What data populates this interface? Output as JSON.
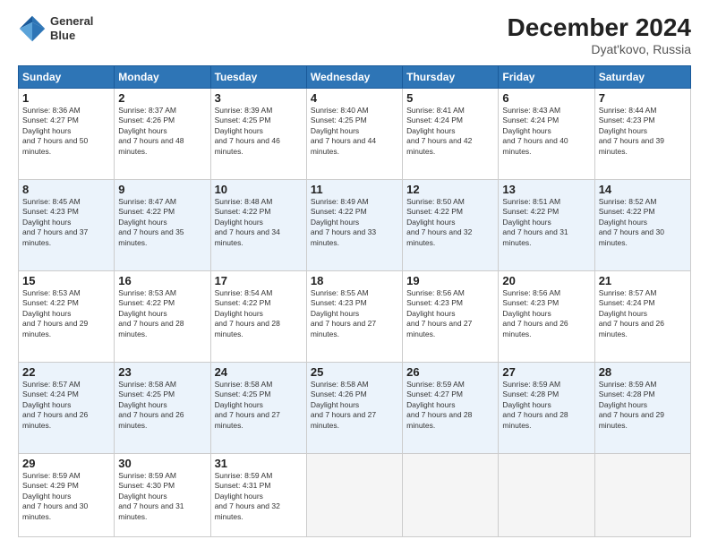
{
  "header": {
    "logo_line1": "General",
    "logo_line2": "Blue",
    "title": "December 2024",
    "subtitle": "Dyat'kovo, Russia"
  },
  "days_of_week": [
    "Sunday",
    "Monday",
    "Tuesday",
    "Wednesday",
    "Thursday",
    "Friday",
    "Saturday"
  ],
  "weeks": [
    {
      "stripe": false,
      "days": [
        {
          "num": "1",
          "rise": "8:36 AM",
          "set": "4:27 PM",
          "daylight": "7 hours and 50 minutes."
        },
        {
          "num": "2",
          "rise": "8:37 AM",
          "set": "4:26 PM",
          "daylight": "7 hours and 48 minutes."
        },
        {
          "num": "3",
          "rise": "8:39 AM",
          "set": "4:25 PM",
          "daylight": "7 hours and 46 minutes."
        },
        {
          "num": "4",
          "rise": "8:40 AM",
          "set": "4:25 PM",
          "daylight": "7 hours and 44 minutes."
        },
        {
          "num": "5",
          "rise": "8:41 AM",
          "set": "4:24 PM",
          "daylight": "7 hours and 42 minutes."
        },
        {
          "num": "6",
          "rise": "8:43 AM",
          "set": "4:24 PM",
          "daylight": "7 hours and 40 minutes."
        },
        {
          "num": "7",
          "rise": "8:44 AM",
          "set": "4:23 PM",
          "daylight": "7 hours and 39 minutes."
        }
      ]
    },
    {
      "stripe": true,
      "days": [
        {
          "num": "8",
          "rise": "8:45 AM",
          "set": "4:23 PM",
          "daylight": "7 hours and 37 minutes."
        },
        {
          "num": "9",
          "rise": "8:47 AM",
          "set": "4:22 PM",
          "daylight": "7 hours and 35 minutes."
        },
        {
          "num": "10",
          "rise": "8:48 AM",
          "set": "4:22 PM",
          "daylight": "7 hours and 34 minutes."
        },
        {
          "num": "11",
          "rise": "8:49 AM",
          "set": "4:22 PM",
          "daylight": "7 hours and 33 minutes."
        },
        {
          "num": "12",
          "rise": "8:50 AM",
          "set": "4:22 PM",
          "daylight": "7 hours and 32 minutes."
        },
        {
          "num": "13",
          "rise": "8:51 AM",
          "set": "4:22 PM",
          "daylight": "7 hours and 31 minutes."
        },
        {
          "num": "14",
          "rise": "8:52 AM",
          "set": "4:22 PM",
          "daylight": "7 hours and 30 minutes."
        }
      ]
    },
    {
      "stripe": false,
      "days": [
        {
          "num": "15",
          "rise": "8:53 AM",
          "set": "4:22 PM",
          "daylight": "7 hours and 29 minutes."
        },
        {
          "num": "16",
          "rise": "8:53 AM",
          "set": "4:22 PM",
          "daylight": "7 hours and 28 minutes."
        },
        {
          "num": "17",
          "rise": "8:54 AM",
          "set": "4:22 PM",
          "daylight": "7 hours and 28 minutes."
        },
        {
          "num": "18",
          "rise": "8:55 AM",
          "set": "4:23 PM",
          "daylight": "7 hours and 27 minutes."
        },
        {
          "num": "19",
          "rise": "8:56 AM",
          "set": "4:23 PM",
          "daylight": "7 hours and 27 minutes."
        },
        {
          "num": "20",
          "rise": "8:56 AM",
          "set": "4:23 PM",
          "daylight": "7 hours and 26 minutes."
        },
        {
          "num": "21",
          "rise": "8:57 AM",
          "set": "4:24 PM",
          "daylight": "7 hours and 26 minutes."
        }
      ]
    },
    {
      "stripe": true,
      "days": [
        {
          "num": "22",
          "rise": "8:57 AM",
          "set": "4:24 PM",
          "daylight": "7 hours and 26 minutes."
        },
        {
          "num": "23",
          "rise": "8:58 AM",
          "set": "4:25 PM",
          "daylight": "7 hours and 26 minutes."
        },
        {
          "num": "24",
          "rise": "8:58 AM",
          "set": "4:25 PM",
          "daylight": "7 hours and 27 minutes."
        },
        {
          "num": "25",
          "rise": "8:58 AM",
          "set": "4:26 PM",
          "daylight": "7 hours and 27 minutes."
        },
        {
          "num": "26",
          "rise": "8:59 AM",
          "set": "4:27 PM",
          "daylight": "7 hours and 28 minutes."
        },
        {
          "num": "27",
          "rise": "8:59 AM",
          "set": "4:28 PM",
          "daylight": "7 hours and 28 minutes."
        },
        {
          "num": "28",
          "rise": "8:59 AM",
          "set": "4:28 PM",
          "daylight": "7 hours and 29 minutes."
        }
      ]
    },
    {
      "stripe": false,
      "days": [
        {
          "num": "29",
          "rise": "8:59 AM",
          "set": "4:29 PM",
          "daylight": "7 hours and 30 minutes."
        },
        {
          "num": "30",
          "rise": "8:59 AM",
          "set": "4:30 PM",
          "daylight": "7 hours and 31 minutes."
        },
        {
          "num": "31",
          "rise": "8:59 AM",
          "set": "4:31 PM",
          "daylight": "7 hours and 32 minutes."
        },
        null,
        null,
        null,
        null
      ]
    }
  ]
}
